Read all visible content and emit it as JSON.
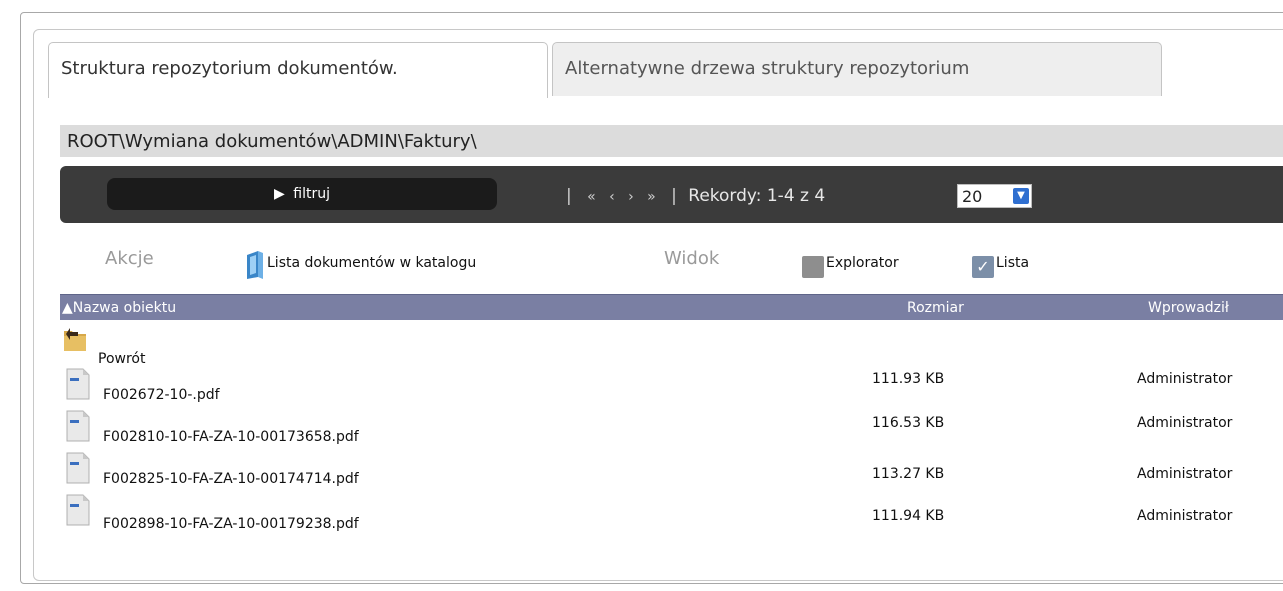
{
  "tabs": [
    {
      "label": "Struktura repozytorium dokumentów.",
      "active": true
    },
    {
      "label": "Alternatywne drzewa struktury repozytorium",
      "active": false
    }
  ],
  "breadcrumb": "ROOT\\Wymiana dokumentów\\ADMIN\\Faktury\\",
  "toolbar": {
    "filter_label": "filtruj",
    "pager": {
      "sep": "|",
      "first": "«",
      "prev": "‹",
      "next": "›",
      "last": "»",
      "records": "Rekordy: 1-4 z 4",
      "page_size": "20"
    }
  },
  "actions": {
    "actions_label": "Akcje",
    "doc_list_label": "Lista dokumentów w katalogu",
    "view_label": "Widok",
    "explorer_label": "Explorator",
    "list_label": "Lista"
  },
  "table": {
    "sort_indicator": "▲",
    "columns": {
      "name": "Nazwa obiektu",
      "size": "Rozmiar",
      "author": "Wprowadził"
    },
    "back_label": "Powrót",
    "rows": [
      {
        "name": "F002672-10-.pdf",
        "size": "111.93 KB",
        "author": "Administrator"
      },
      {
        "name": "F002810-10-FA-ZA-10-00173658.pdf",
        "size": "116.53 KB",
        "author": "Administrator"
      },
      {
        "name": "F002825-10-FA-ZA-10-00174714.pdf",
        "size": "113.27 KB",
        "author": "Administrator"
      },
      {
        "name": "F002898-10-FA-ZA-10-00179238.pdf",
        "size": "111.94 KB",
        "author": "Administrator"
      }
    ]
  },
  "colors": {
    "toolbar_bg": "#3b3b3b",
    "header_bg": "#7a7fa3",
    "breadcrumb_bg": "#dcdcdc"
  }
}
